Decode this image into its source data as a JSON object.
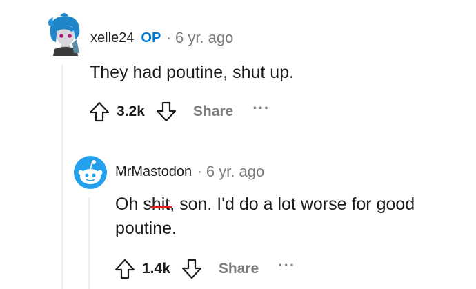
{
  "comments": [
    {
      "username": "xelle24",
      "badge": "OP",
      "separator": "·",
      "timestamp": "6 yr. ago",
      "body": "They had poutine, shut up.",
      "score": "3.2k",
      "share_label": "Share",
      "more_label": "···",
      "avatar_icon": "anime-character-avatar"
    },
    {
      "username": "MrMastodon",
      "separator": "·",
      "timestamp": "6 yr. ago",
      "body_before": "Oh s",
      "body_strike": "hit",
      "body_line1_after": ", son. I'd do a lot worse for good",
      "body_line2": "poutine.",
      "score": "1.4k",
      "share_label": "Share",
      "more_label": "···",
      "avatar_icon": "snoo-avatar"
    }
  ],
  "colors": {
    "op_badge": "#0079d3",
    "meta_gray": "#7c7c7c",
    "thread_line": "#edeff1",
    "strike_red": "#e0201a",
    "snoo_blue": "#24a0ed"
  }
}
